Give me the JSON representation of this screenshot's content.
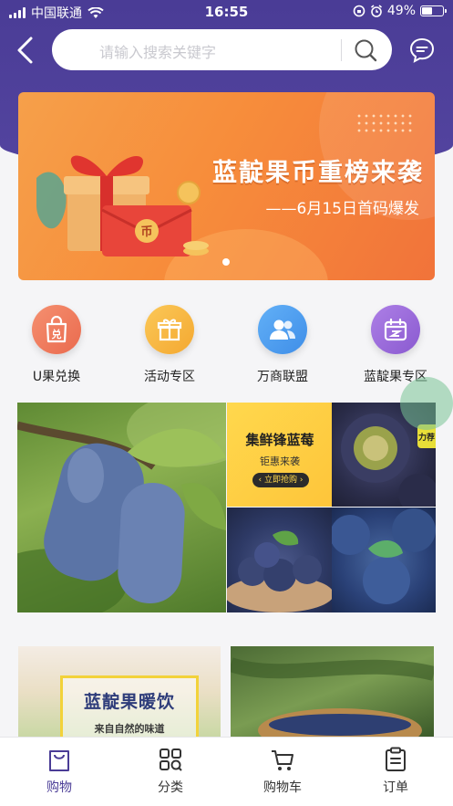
{
  "status_bar": {
    "carrier": "中国联通",
    "time": "16:55",
    "battery": "49%",
    "battery_level": 0.49
  },
  "search": {
    "placeholder": "请输入搜索关键字"
  },
  "banner": {
    "title": "蓝靛果币重榜来袭",
    "subtitle": "——6月15日首码爆发",
    "coin_char": "币",
    "page_count": 1,
    "active_index": 0
  },
  "categories": [
    {
      "label": "U果兑换",
      "icon": "exchange-bag-icon",
      "color": "#f07a5a"
    },
    {
      "label": "活动专区",
      "icon": "gift-icon",
      "color": "#f7b73e"
    },
    {
      "label": "万商联盟",
      "icon": "users-icon",
      "color": "#4b9cf0"
    },
    {
      "label": "蓝靛果专区",
      "icon": "calendar-icon",
      "color": "#9a6ad8"
    }
  ],
  "promo": {
    "ad_title": "集鲜锋蓝莓",
    "ad_subtitle": "钜惠来袭",
    "ad_button": "‹ 立即抢购 ›",
    "tag": "力荐"
  },
  "cards": [
    {
      "title": "蓝靛果暖饮",
      "subtitle": "来自自然的味道"
    }
  ],
  "tabbar": [
    {
      "label": "购物",
      "icon": "shopping-bag-icon",
      "active": true
    },
    {
      "label": "分类",
      "icon": "category-grid-icon",
      "active": false
    },
    {
      "label": "购物车",
      "icon": "cart-icon",
      "active": false
    },
    {
      "label": "订单",
      "icon": "order-clipboard-icon",
      "active": false
    }
  ],
  "colors": {
    "brand": "#4a3c96",
    "banner": "#f78d3b"
  }
}
